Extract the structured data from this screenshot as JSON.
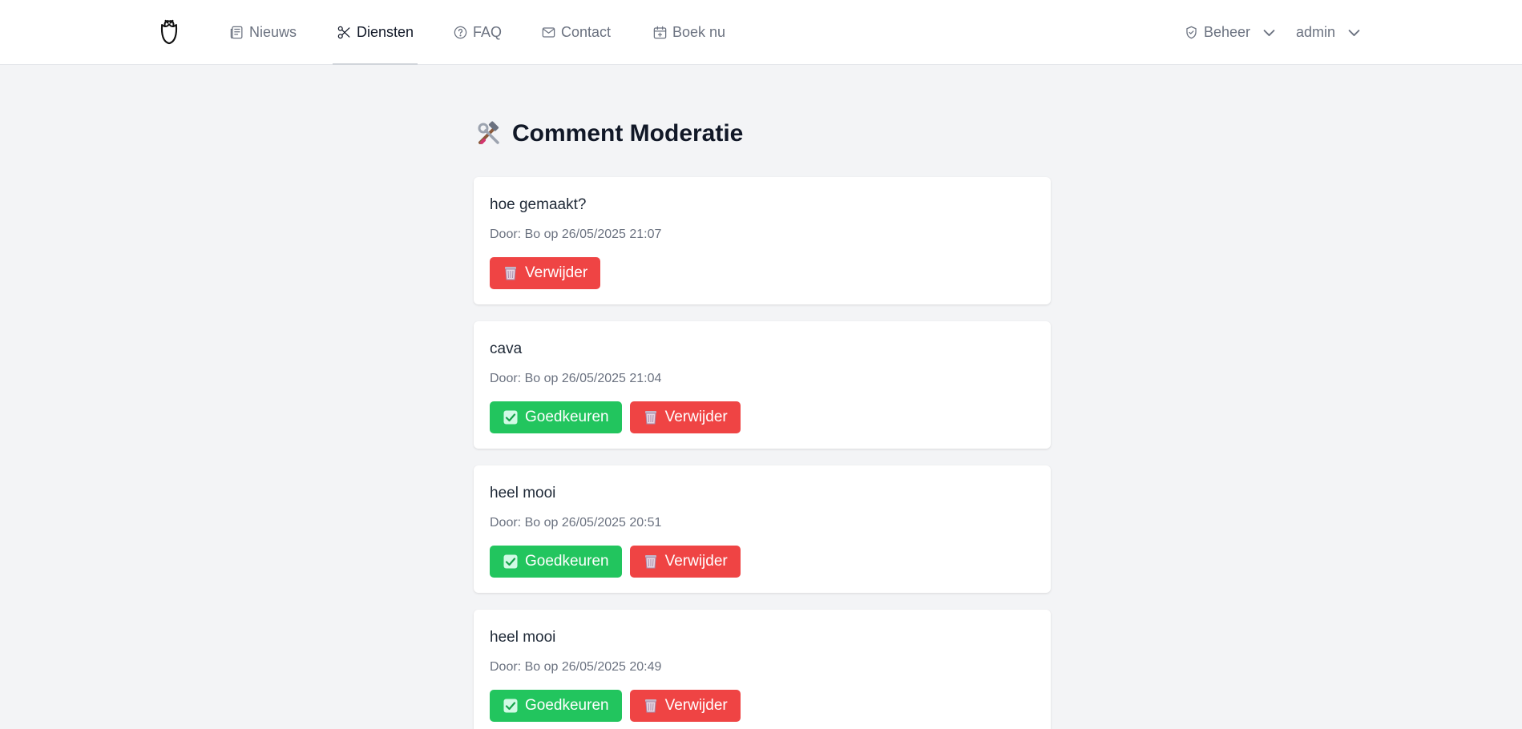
{
  "nav": {
    "items": [
      {
        "label": "Nieuws",
        "icon": "newspaper-icon"
      },
      {
        "label": "Diensten",
        "icon": "scissors-icon",
        "active": true
      },
      {
        "label": "FAQ",
        "icon": "question-circle-icon"
      },
      {
        "label": "Contact",
        "icon": "envelope-icon"
      },
      {
        "label": "Boek nu",
        "icon": "calendar-plus-icon"
      }
    ],
    "beheer_label": "Beheer",
    "user_label": "admin"
  },
  "page": {
    "title": "Comment Moderatie",
    "title_icon": "hammer-wrench-icon"
  },
  "comments": [
    {
      "text": "hoe gemaakt?",
      "meta": "Door: Bo op 26/05/2025 21:07",
      "approve_label": null,
      "delete_label": "Verwijder"
    },
    {
      "text": "cava",
      "meta": "Door: Bo op 26/05/2025 21:04",
      "approve_label": "Goedkeuren",
      "delete_label": "Verwijder"
    },
    {
      "text": "heel mooi",
      "meta": "Door: Bo op 26/05/2025 20:51",
      "approve_label": "Goedkeuren",
      "delete_label": "Verwijder"
    },
    {
      "text": "heel mooi",
      "meta": "Door: Bo op 26/05/2025 20:49",
      "approve_label": "Goedkeuren",
      "delete_label": "Verwijder"
    }
  ],
  "colors": {
    "approve": "#22c55e",
    "delete": "#ef4444",
    "background": "#f3f4f6"
  }
}
